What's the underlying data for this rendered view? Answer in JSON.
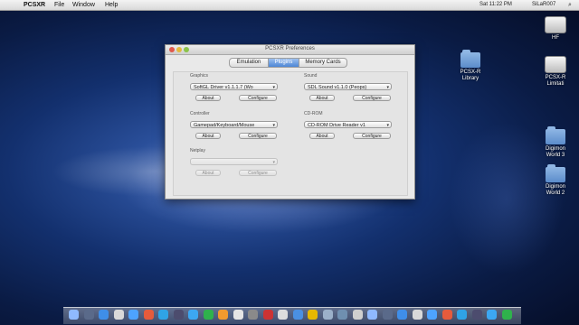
{
  "menubar": {
    "apple": "",
    "app": "PCSXR",
    "items": [
      "File",
      "Window",
      "Help"
    ],
    "status": [
      "",
      "",
      "",
      "",
      ""
    ],
    "clock": "Sat 11:22 PM",
    "user": "SiLaR007",
    "spotlight": "⌕"
  },
  "desktop_icons": [
    {
      "label": "HF",
      "kind": "drive"
    },
    {
      "label": "PCSX-R\nLibrary",
      "kind": "folder"
    },
    {
      "label": "PCSX-R\nLimitati",
      "kind": "drive"
    },
    {
      "label": "Digimon\nWorld 3",
      "kind": "folder"
    },
    {
      "label": "Digimon\nWorld 2",
      "kind": "folder"
    }
  ],
  "dialog": {
    "title": "PCSXR Preferences",
    "tabs": [
      "Emulation",
      "Plugins",
      "Memory Cards"
    ],
    "graphics": {
      "label": "Graphics",
      "value": "SoftGL Driver v1.1.1.7 (Wo",
      "about": "About",
      "configure": "Configure"
    },
    "sound": {
      "label": "Sound",
      "value": "SDL Sound v1.1.0 (Peops)",
      "about": "About",
      "configure": "Configure"
    },
    "controller": {
      "label": "Controller",
      "value": "Gamepad/Keyboard/Mouse",
      "about": "About",
      "configure": "Configure"
    },
    "cdrom": {
      "label": "CD-ROM",
      "value": "CD-ROM Drive Reader v1",
      "about": "About",
      "configure": "Configure"
    },
    "netplay": {
      "label": "Netplay",
      "value": "",
      "about": "About",
      "configure": "Configure"
    }
  },
  "dock": {
    "count": 30
  }
}
